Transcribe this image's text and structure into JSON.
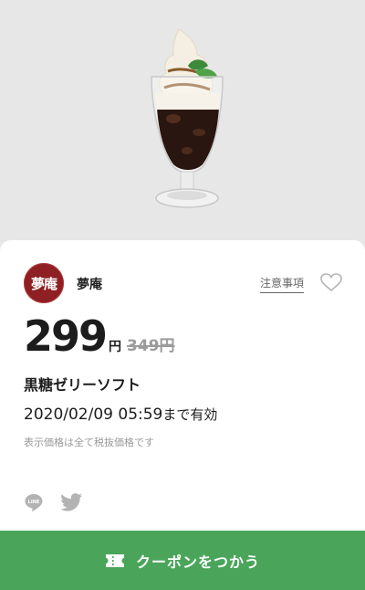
{
  "product_image": {
    "icon": "parfait-photo"
  },
  "shop": {
    "name": "夢庵",
    "logo_text": "夢庵"
  },
  "notes_link": "注意事項",
  "favorite_icon": "heart-icon",
  "price": {
    "current": "299",
    "currency": "円",
    "original": "349円"
  },
  "product_name": "黒糖ゼリーソフト",
  "validity": {
    "date": "2020/02/09 05:59",
    "suffix": "まで有効"
  },
  "tax_note": "表示価格は全て税抜価格です",
  "share": {
    "line_icon": "line-icon",
    "twitter_icon": "twitter-icon"
  },
  "coupon_button": {
    "label": "クーポンをつかう",
    "icon": "ticket-icon",
    "color": "#4aa55b"
  },
  "colors": {
    "brand": "#8e1f22",
    "accent": "#4aa55b"
  }
}
